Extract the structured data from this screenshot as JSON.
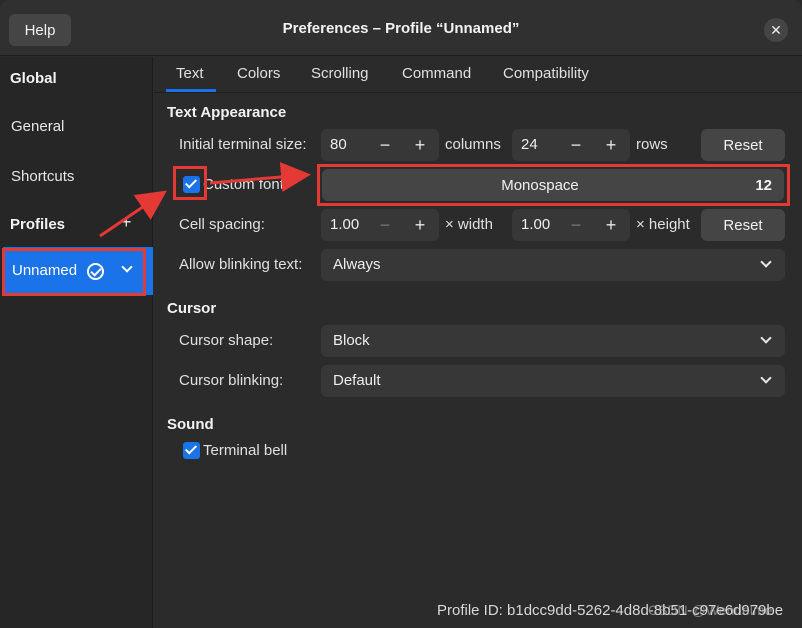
{
  "titlebar": {
    "help_label": "Help",
    "title": "Preferences – Profile “Unnamed”",
    "close_glyph": "✕"
  },
  "sidebar": {
    "global_heading": "Global",
    "general": "General",
    "shortcuts": "Shortcuts",
    "profiles_heading": "Profiles",
    "add_glyph": "+",
    "profile_selected": "Unnamed"
  },
  "tabs": [
    "Text",
    "Colors",
    "Scrolling",
    "Command",
    "Compatibility"
  ],
  "text_appearance": {
    "heading": "Text Appearance",
    "size_label": "Initial terminal size:",
    "columns_value": "80",
    "columns_unit": "columns",
    "rows_value": "24",
    "rows_unit": "rows",
    "reset_label": "Reset",
    "custom_font_label": "Custom font:",
    "font_name": "Monospace",
    "font_size": "12",
    "cell_spacing_label": "Cell spacing:",
    "width_value": "1.00",
    "width_unit": "× width",
    "height_value": "1.00",
    "height_unit": "× height",
    "blink_label": "Allow blinking text:",
    "blink_value": "Always"
  },
  "cursor": {
    "heading": "Cursor",
    "shape_label": "Cursor shape:",
    "shape_value": "Block",
    "blinking_label": "Cursor blinking:",
    "blinking_value": "Default"
  },
  "sound": {
    "heading": "Sound",
    "bell_label": "Terminal bell"
  },
  "footer": {
    "profile_id": "Profile ID:  b1dcc9dd-5262-4d8d-8b51-c97e6d979be"
  },
  "watermark": "CSDN @Wendelme",
  "colors": {
    "accent": "#1a73e8",
    "annotation": "#e53935"
  }
}
